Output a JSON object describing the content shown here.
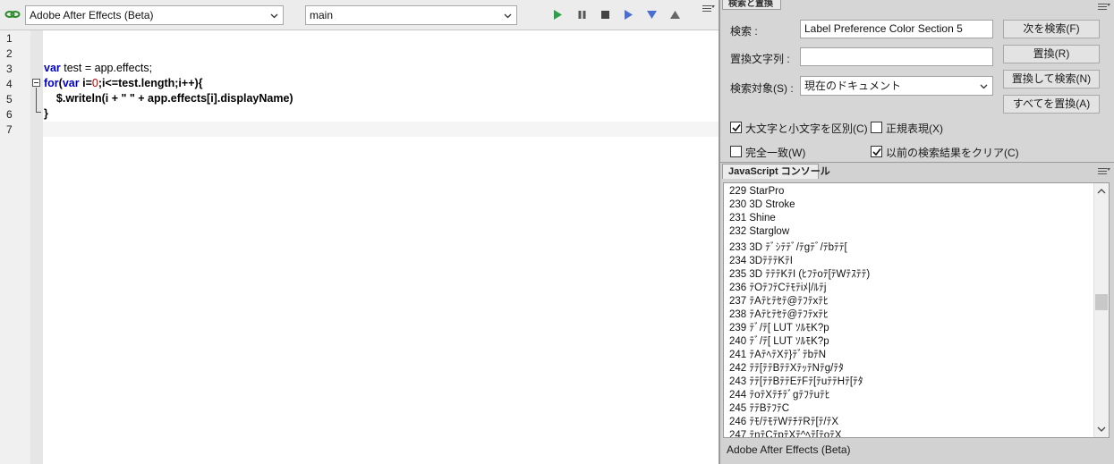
{
  "editor": {
    "target_app": "Adobe After Effects (Beta)",
    "function": "main",
    "line_numbers": [
      "1",
      "2",
      "3",
      "4",
      "5",
      "6",
      "7"
    ],
    "code": {
      "line3_kw": "var",
      "line3_rest": " test = app.effects;",
      "line4_kw1": "for",
      "line4_p1": "(",
      "line4_kw2": "var",
      "line4_p2": " i=",
      "line4_num": "0",
      "line4_p3": ";i<=test.length;i++){",
      "line5": "    $.writeln(i + \" \" + app.effects[i].displayName)",
      "line6": "}"
    }
  },
  "find": {
    "tab_label": "検索と置換",
    "search_label": "検索 :",
    "search_value": "Label Preference Color Section 5",
    "replace_label": "置換文字列 :",
    "replace_value": "",
    "scope_label": "検索対象(S) :",
    "scope_value": "現在のドキュメント",
    "btn_find_next": "次を検索(F)",
    "btn_replace": "置換(R)",
    "btn_replace_find": "置換して検索(N)",
    "btn_replace_all": "すべてを置換(A)",
    "opt_case": "大文字と小文字を区別(C)",
    "opt_regex": "正規表現(X)",
    "opt_whole": "完全一致(W)",
    "opt_clear": "以前の検索結果をクリア(C)",
    "opt_case_checked": true,
    "opt_regex_checked": false,
    "opt_whole_checked": false,
    "opt_clear_checked": true
  },
  "console": {
    "tab_label": "JavaScript コンソール",
    "lines": [
      "229 StarPro",
      "230 3D Stroke",
      "231 Shine",
      "232 Starglow",
      "233 3D ﾃﾞｼﾃﾃﾞ/ﾃgﾃﾞ/ﾃbﾃﾃ[",
      "234 3DﾃﾃﾃKﾃI",
      "235 3D ﾃﾃﾃKﾃI (ﾋﾌﾃoﾃ[ﾃWﾃｽﾃﾃ)",
      "236 ﾃOﾃﾌﾃCﾃﾓﾃiﾒ|/ﾙﾃj",
      "237 ﾃAﾃﾋﾃｾﾃ@ﾃﾌﾃxﾃﾋ",
      "238 ﾃAﾃﾋﾃｾﾃ@ﾃﾌﾃxﾃﾋ",
      "239 ﾃﾞ/ﾃ[ LUT ｿﾙﾓK?p",
      "240 ﾃﾞ/ﾃ[ LUT ｿﾙﾓK?p",
      "241 ﾃAﾃﾍﾃXﾃ}ﾃﾞﾃbﾃN",
      "242 ﾃﾃ[ﾃﾃBﾃﾃXﾃｯﾃNﾃg/ﾃﾀ",
      "243 ﾃﾃ[ﾃﾃBﾃﾃEﾃFﾃ[ﾃuﾃﾃHﾃ[ﾃﾀ",
      "244 ﾃoﾃXﾃﾁﾃﾞgﾃﾌﾃuﾃﾋ",
      "245 ﾃﾃBﾃﾌﾃC",
      "246 ﾃﾓ/ﾃﾓﾃWﾃﾁﾃRﾃ[ﾃ/ﾃX",
      "247 ﾃnﾃCﾃpﾃXﾃ^ﾍﾃ[ﾃoﾃX"
    ],
    "footer_target": "Adobe After Effects (Beta)"
  }
}
